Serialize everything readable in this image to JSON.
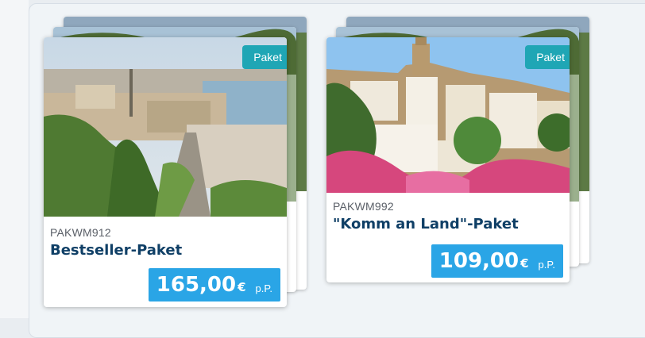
{
  "packages": [
    {
      "badge": "Paket",
      "code": "PAKWM912",
      "title": "Bestseller-Paket",
      "price": "165,00",
      "currency": "€",
      "per_person": "p.P.",
      "image_icon": "city-harbor-photo"
    },
    {
      "badge": "Paket",
      "code": "PAKWM992",
      "title": "\"Komm an Land\"-Paket",
      "price": "109,00",
      "currency": "€",
      "per_person": "p.P.",
      "image_icon": "hillside-town-photo"
    }
  ],
  "colors": {
    "badge": "#1fa6b5",
    "price": "#2aa5e6",
    "title": "#0f3f66"
  }
}
